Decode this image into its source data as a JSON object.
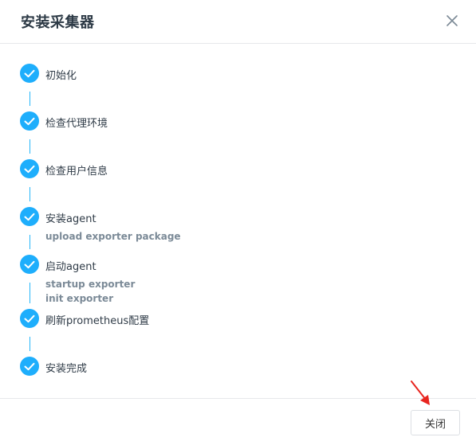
{
  "dialog": {
    "title": "安装采集器",
    "close_icon": "close-icon",
    "close_button_label": "关闭"
  },
  "steps": [
    {
      "title": "初始化",
      "status": "done",
      "details": []
    },
    {
      "title": "检查代理环境",
      "status": "done",
      "details": []
    },
    {
      "title": "检查用户信息",
      "status": "done",
      "details": []
    },
    {
      "title": "安装agent",
      "status": "done",
      "details": [
        "upload exporter package"
      ]
    },
    {
      "title": "启动agent",
      "status": "done",
      "details": [
        "startup exporter",
        "init exporter"
      ]
    },
    {
      "title": "刷新prometheus配置",
      "status": "done",
      "details": []
    },
    {
      "title": "安装完成",
      "status": "done",
      "details": []
    }
  ],
  "colors": {
    "accent": "#1eaefc",
    "connector": "#27b7fa",
    "annotation_arrow": "#e8251f"
  }
}
